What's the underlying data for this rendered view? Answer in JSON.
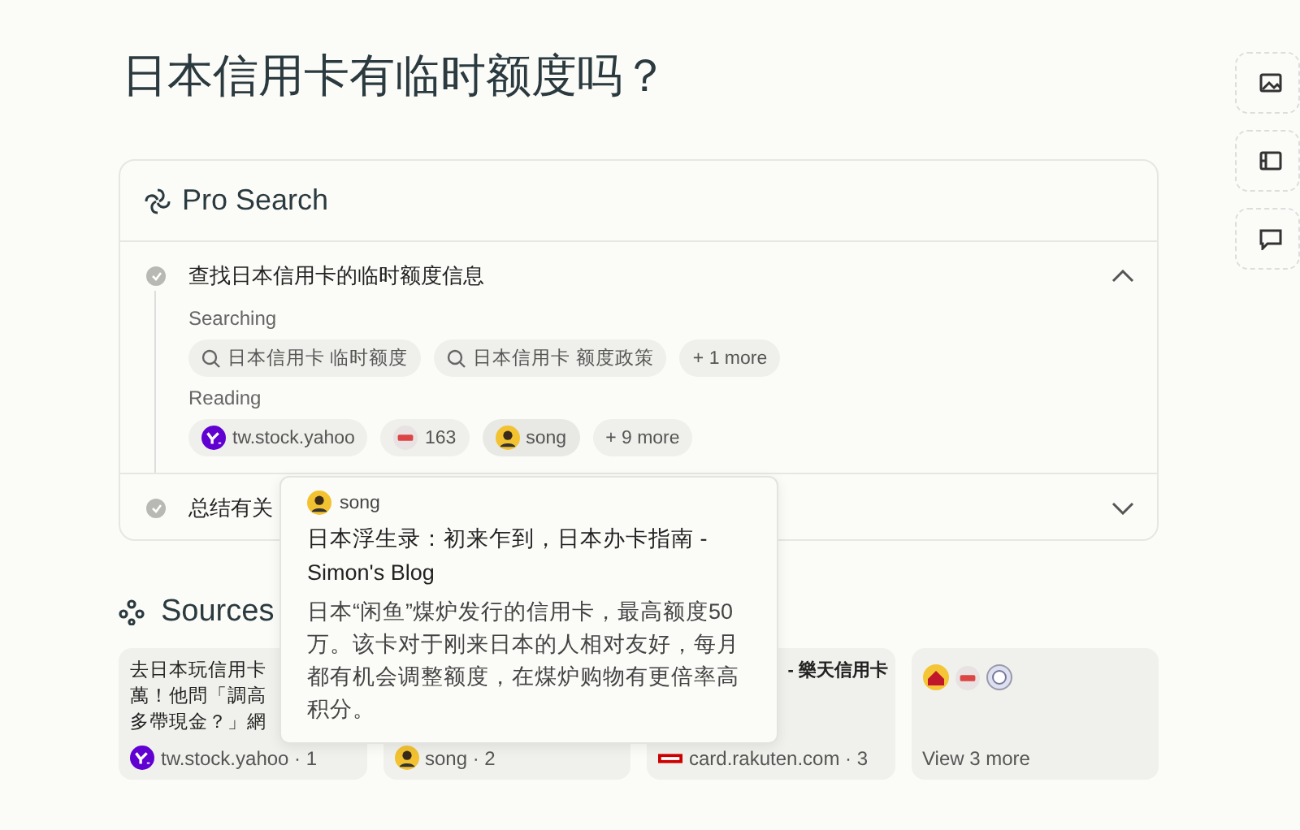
{
  "question": "日本信用卡有临时额度吗？",
  "side_buttons": [
    {
      "kind": "image"
    },
    {
      "kind": "video"
    },
    {
      "kind": "chat"
    }
  ],
  "pro_search": {
    "title": "Pro Search",
    "steps": [
      {
        "text": "查找日本信用卡的临时额度信息",
        "expanded": true,
        "searching_label": "Searching",
        "queries": [
          {
            "text": "日本信用卡 临时额度",
            "kind": "query"
          },
          {
            "text": "日本信用卡 额度政策",
            "kind": "query"
          },
          {
            "text": "+ 1 more",
            "kind": "more"
          }
        ],
        "reading_label": "Reading",
        "sources": [
          {
            "text": "tw.stock.yahoo",
            "kind": "yahoo"
          },
          {
            "text": "163",
            "kind": "netease"
          },
          {
            "text": "song",
            "kind": "avatar"
          },
          {
            "text": "+ 9 more",
            "kind": "more"
          }
        ]
      },
      {
        "text": "总结有关",
        "expanded": false
      }
    ]
  },
  "sources": {
    "title": "Sources",
    "cards": [
      {
        "kind": "yahoo",
        "title_lines": [
          "去日本玩信用卡",
          "萬！他問「調高",
          "多帶現金？」網"
        ],
        "site": "tw.stock.yahoo · 1"
      },
      {
        "kind": "avatar",
        "site": "song · 2"
      },
      {
        "kind": "rakuten",
        "title_lines": [
          "- 樂天信用卡"
        ],
        "site": "card.rakuten.com · 3"
      },
      {
        "kind": "more",
        "label": "View 3 more"
      }
    ]
  },
  "popover": {
    "author": "song",
    "title": "日本浮生录：初来乍到，日本办卡指南 - Simon's Blog",
    "snippet": "日本“闲鱼”煤炉发行的信用卡，最高额度50万。该卡对于刚来日本的人相对友好，每月都有机会调整额度，在煤炉购物有更倍率高积分。"
  }
}
